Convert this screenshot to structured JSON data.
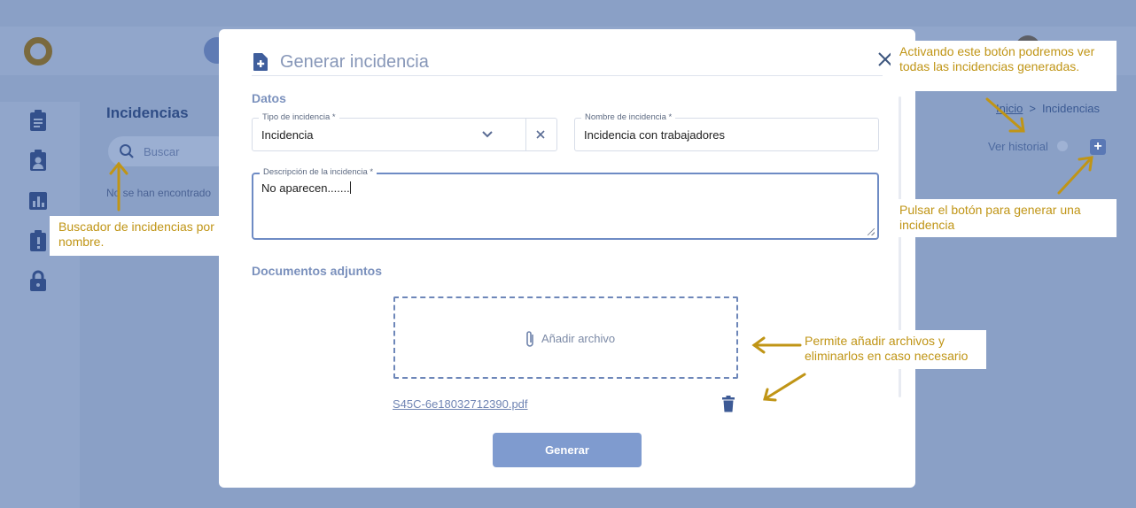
{
  "app": {
    "page_title": "Incidencias",
    "search_placeholder": "Buscar",
    "empty_message": "No se han encontrado",
    "breadcrumb": {
      "home": "Inicio",
      "separator": ">",
      "current": "Incidencias"
    },
    "history_label": "Ver historial",
    "add_label": "+"
  },
  "modal": {
    "title": "Generar incidencia",
    "section_data": "Datos",
    "tipo": {
      "label": "Tipo de incidencia *",
      "value": "Incidencia"
    },
    "nombre": {
      "label": "Nombre de incidencia *",
      "value": "Incidencia con trabajadores"
    },
    "descripcion": {
      "label": "Descripción de la incidencia *",
      "value": "No aparecen......."
    },
    "section_docs": "Documentos adjuntos",
    "dropzone_label": "Añadir archivo",
    "attached_file": "S45C-6e18032712390.pdf",
    "submit_label": "Generar"
  },
  "callouts": {
    "history": "Activando este botón podremos ver todas las incidencias generadas.",
    "add": "Pulsar el botón para generar una incidencia",
    "search": "Buscador de incidencias por nombre.",
    "files": "Permite añadir archivos y eliminarlos en caso necesario"
  },
  "colors": {
    "backdrop": "#8aa0c6",
    "primary": "#7f9bcf",
    "callout_text": "#c09516",
    "arrow": "#c09516"
  }
}
